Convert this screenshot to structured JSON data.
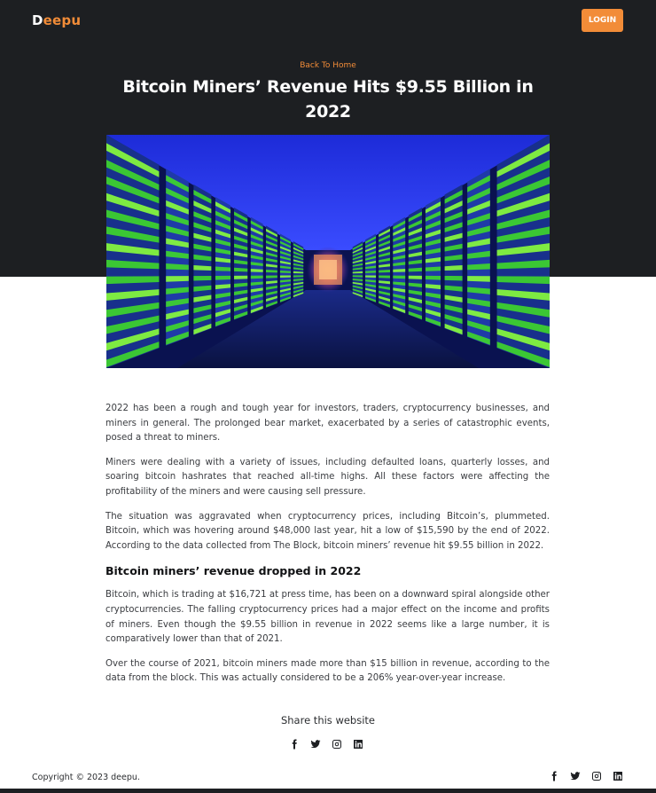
{
  "header": {
    "logo_first": "D",
    "logo_rest": "eepu",
    "login_label": "LOGIN"
  },
  "article": {
    "back_link": "Back To Home",
    "title": "Bitcoin Miners’ Revenue Hits $9.55 Billion in 2022",
    "paragraphs": [
      "2022 has been a rough and tough year for investors, traders, cryptocurrency businesses, and miners in general. The prolonged bear market, exacerbated by a series of catastrophic events, posed a threat to miners.",
      "Miners were dealing with a variety of issues, including defaulted loans, quarterly losses, and soaring bitcoin hashrates that reached all-time highs. All these factors were affecting the profitability of the miners and were causing sell pressure.",
      "The situation was aggravated when cryptocurrency prices, including Bitcoin’s, plummeted. Bitcoin, which was hovering around $48,000 last year, hit a low of $15,590 by the end of 2022. According to the data collected from The Block, bitcoin miners’ revenue hit $9.55 billion in 2022."
    ],
    "subheading": "Bitcoin miners’ revenue dropped in 2022",
    "paragraphs2": [
      "Bitcoin, which is trading at $16,721 at press time, has been on a downward spiral alongside other cryptocurrencies. The falling cryptocurrency prices had a major effect on the income and profits of miners. Even though the $9.55 billion in revenue in 2022 seems like a large number, it is comparatively lower than that of 2021.",
      "Over the course of 2021, bitcoin miners made more than $15 billion in revenue, according to the data from the block. This was actually considered to be a 206% year-over-year increase."
    ]
  },
  "share": {
    "title": "Share this website",
    "icons": [
      "facebook-icon",
      "twitter-icon",
      "instagram-icon",
      "linkedin-icon"
    ]
  },
  "footer": {
    "copyright": "Copyright © 2023 deepu."
  },
  "colors": {
    "accent": "#f28c38",
    "dark": "#1d1f22"
  }
}
